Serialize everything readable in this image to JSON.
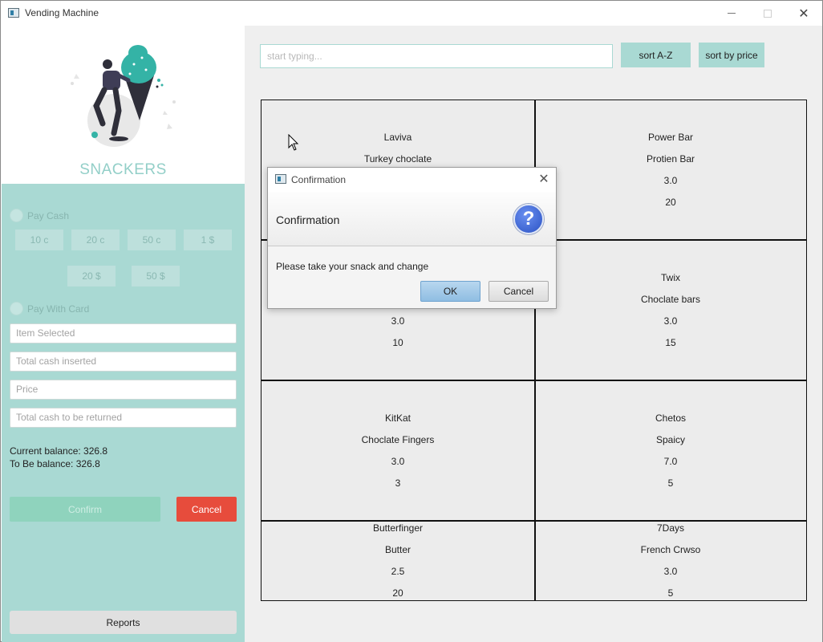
{
  "window": {
    "title": "Vending Machine"
  },
  "brand": {
    "name": "SNACKERS"
  },
  "payment": {
    "pay_cash_label": "Pay Cash",
    "coins": [
      "10 c",
      "20 c",
      "50 c",
      "1 $"
    ],
    "notes": [
      "20 $",
      "50 $"
    ],
    "pay_card_label": "Pay With Card"
  },
  "fields": {
    "item_selected_placeholder": "Item Selected",
    "total_cash_placeholder": "Total cash inserted",
    "price_placeholder": "Price",
    "cash_returned_placeholder": "Total cash to be returned"
  },
  "balance": {
    "current": "Current balance: 326.8",
    "to_be": "To Be balance: 326.8"
  },
  "actions": {
    "confirm": "Confirm",
    "cancel": "Cancel",
    "reports": "Reports"
  },
  "search": {
    "placeholder": "start typing...",
    "sort_az": "sort A-Z",
    "sort_price": "sort by price"
  },
  "products": [
    {
      "name": "Laviva",
      "desc": "Turkey choclate",
      "price": "",
      "qty": ""
    },
    {
      "name": "Power Bar",
      "desc": "Protien Bar",
      "price": "3.0",
      "qty": "20"
    },
    {
      "name": "",
      "desc": "",
      "price": "3.0",
      "qty": "10"
    },
    {
      "name": "Twix",
      "desc": "Choclate bars",
      "price": "3.0",
      "qty": "15"
    },
    {
      "name": "KitKat",
      "desc": "Choclate Fingers",
      "price": "3.0",
      "qty": "3"
    },
    {
      "name": "Chetos",
      "desc": "Spaicy",
      "price": "7.0",
      "qty": "5"
    },
    {
      "name": "Butterfinger",
      "desc": "Butter",
      "price": "2.5",
      "qty": "20"
    },
    {
      "name": "7Days",
      "desc": "French Crwso",
      "price": "3.0",
      "qty": "5"
    }
  ],
  "dialog": {
    "title": "Confirmation",
    "header": "Confirmation",
    "message": "Please take your snack and change",
    "ok": "OK",
    "cancel": "Cancel"
  },
  "colors": {
    "mint": "#a9d9d3",
    "brand_text": "#93cfc8",
    "cancel_red": "#e74c3c",
    "confirm_green": "#8fd3bd"
  }
}
